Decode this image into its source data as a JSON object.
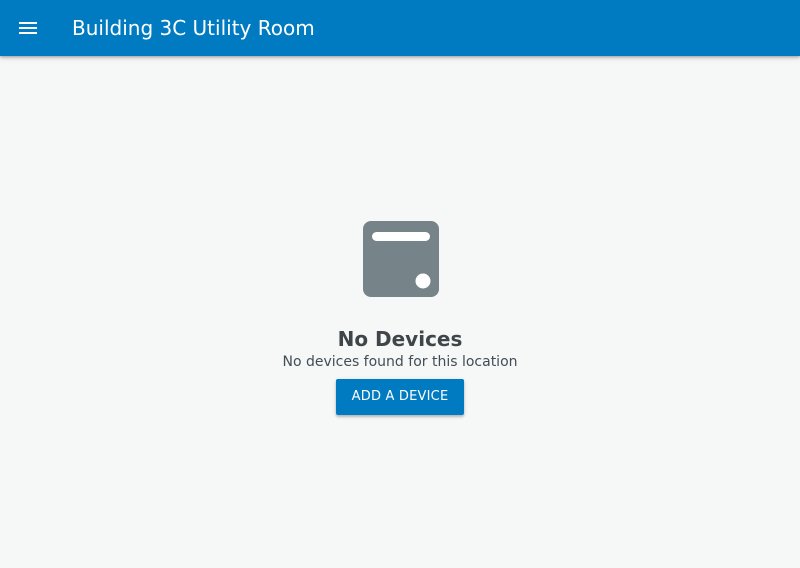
{
  "header": {
    "title": "Building 3C Utility Room",
    "menu_icon": "menu-icon",
    "background_color": "#007bc1"
  },
  "empty_state": {
    "icon": "device-icon",
    "icon_color": "#76848a",
    "title": "No Devices",
    "subtitle": "No devices found for this location",
    "button_label": "ADD A DEVICE",
    "button_color": "#007bc1"
  },
  "colors": {
    "page_background": "#f6f7f7",
    "title_text": "#3f4549",
    "subtitle_text": "#424e54"
  }
}
